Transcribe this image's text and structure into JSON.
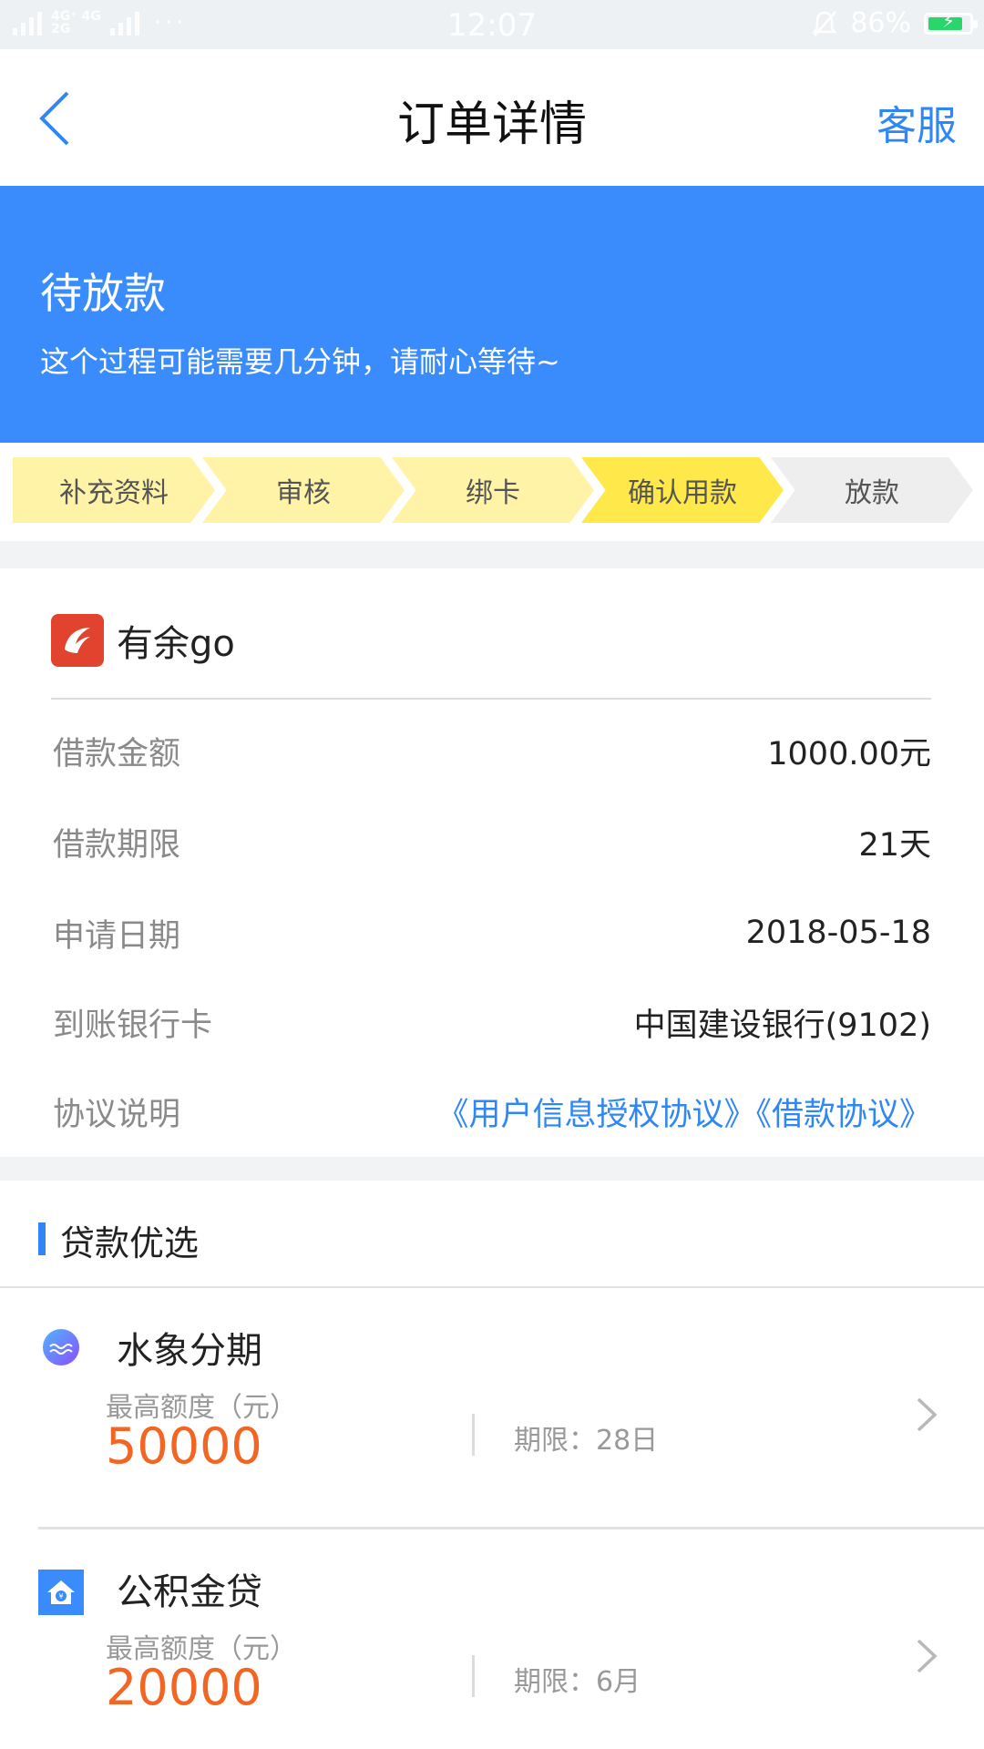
{
  "status_bar": {
    "network": "4G⁺ 4G",
    "network_sub": "2G",
    "time": "12:07",
    "battery_percent": "86%",
    "battery_level": 0.86
  },
  "nav": {
    "title": "订单详情",
    "service_label": "客服"
  },
  "banner": {
    "status": "待放款",
    "tip": "这个过程可能需要几分钟，请耐心等待~"
  },
  "steps": [
    {
      "label": "补充资料",
      "color": "#fff3a8"
    },
    {
      "label": "审核",
      "color": "#fff3a8"
    },
    {
      "label": "绑卡",
      "color": "#fff3a8"
    },
    {
      "label": "确认用款",
      "color": "#ffe84a"
    },
    {
      "label": "放款",
      "color": "#eeeeee"
    }
  ],
  "order": {
    "brand_name": "有余go",
    "rows": [
      {
        "key": "借款金额",
        "value": "1000.00元"
      },
      {
        "key": "借款期限",
        "value": "21天"
      },
      {
        "key": "申请日期",
        "value": "2018-05-18"
      },
      {
        "key": "到账银行卡",
        "value": "中国建设银行(9102)"
      },
      {
        "key": "协议说明",
        "value": "《用户信息授权协议》《借款协议》"
      }
    ]
  },
  "recommend": {
    "title": "贷款优选",
    "items": [
      {
        "name": "水象分期",
        "cap_label": "最高额度（元）",
        "cap": "50000",
        "period": "期限：28日",
        "icon": "water-logo-icon"
      },
      {
        "name": "公积金贷",
        "cap_label": "最高额度（元）",
        "cap": "20000",
        "period": "期限：6月",
        "icon": "house-logo-icon"
      }
    ]
  },
  "colors": {
    "accent_blue": "#3a8bfb",
    "link_blue": "#2f86f5",
    "amount_orange": "#f26522"
  }
}
